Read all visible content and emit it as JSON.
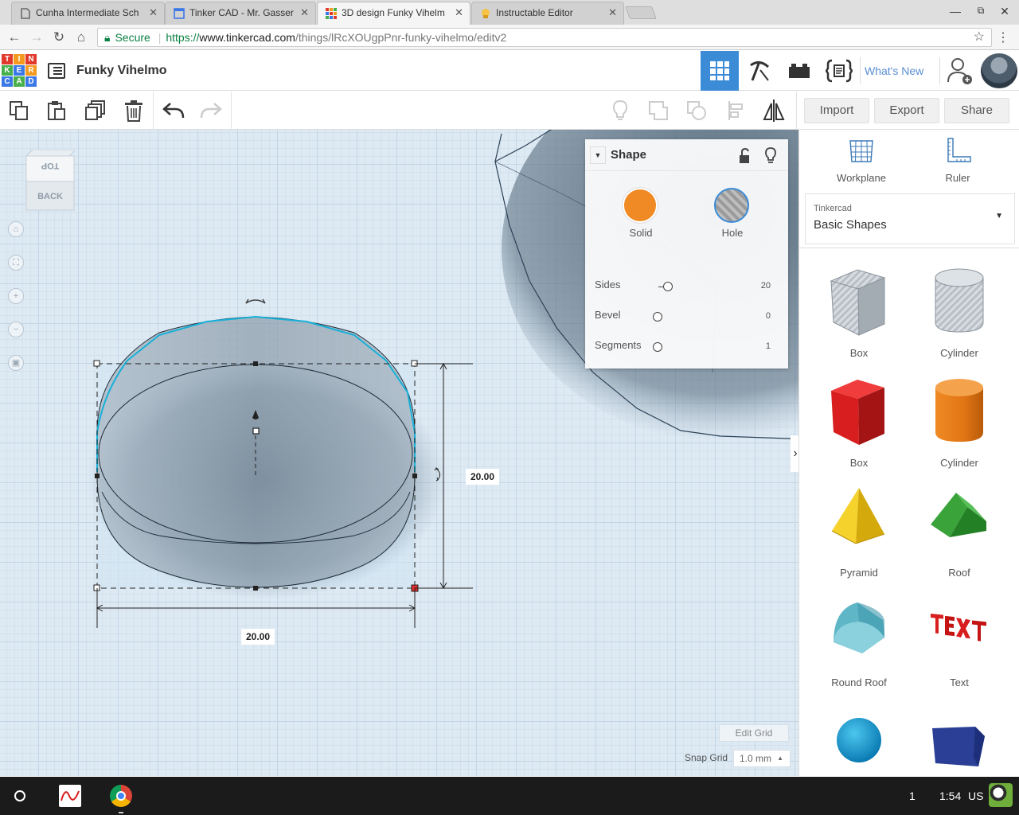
{
  "browser": {
    "tabs": [
      {
        "title": "Cunha Intermediate Sch",
        "icon": "document-icon"
      },
      {
        "title": "Tinker CAD - Mr. Gasser",
        "icon": "sites-icon"
      },
      {
        "title": "3D design Funky Vihelm",
        "icon": "tinkercad-icon",
        "active": true
      },
      {
        "title": "Instructable Editor",
        "icon": "instructables-icon"
      }
    ],
    "secure_label": "Secure",
    "url_scheme": "https://",
    "url_host": "www.tinkercad.com",
    "url_path": "/things/lRcXOUgpPnr-funky-vihelmo/editv2"
  },
  "header": {
    "logo_letters": [
      "T",
      "I",
      "N",
      "K",
      "E",
      "R",
      "C",
      "A",
      "D"
    ],
    "design_title": "Funky Vihelmo",
    "whats_new": "What's New"
  },
  "edit_toolbar": {
    "import": "Import",
    "export": "Export",
    "share": "Share"
  },
  "viewcube": {
    "top": "TOP",
    "back": "BACK"
  },
  "canvas": {
    "width_dim": "20.00",
    "depth_dim": "20.00",
    "edit_grid": "Edit Grid",
    "snap_grid_label": "Snap Grid",
    "snap_grid_value": "1.0 mm"
  },
  "inspector": {
    "title": "Shape",
    "solid_label": "Solid",
    "hole_label": "Hole",
    "solid_color": "#f08a24",
    "properties": [
      {
        "label": "Sides",
        "value": "20"
      },
      {
        "label": "Bevel",
        "value": "0"
      },
      {
        "label": "Segments",
        "value": "1"
      }
    ]
  },
  "panel": {
    "workplane": "Workplane",
    "ruler": "Ruler",
    "library_small": "Tinkercad",
    "library_name": "Basic Shapes",
    "shapes": [
      {
        "label": "Box",
        "icon": "box-hole-icon"
      },
      {
        "label": "Cylinder",
        "icon": "cylinder-hole-icon"
      },
      {
        "label": "Box",
        "icon": "box-icon"
      },
      {
        "label": "Cylinder",
        "icon": "cylinder-icon"
      },
      {
        "label": "Pyramid",
        "icon": "pyramid-icon"
      },
      {
        "label": "Roof",
        "icon": "roof-icon"
      },
      {
        "label": "Round Roof",
        "icon": "round-roof-icon"
      },
      {
        "label": "Text",
        "icon": "text-icon"
      },
      {
        "label": "",
        "icon": "sphere-icon"
      },
      {
        "label": "",
        "icon": "polygon-icon"
      }
    ]
  },
  "taskbar": {
    "notifications": "1",
    "time": "1:54",
    "lang": "US"
  }
}
